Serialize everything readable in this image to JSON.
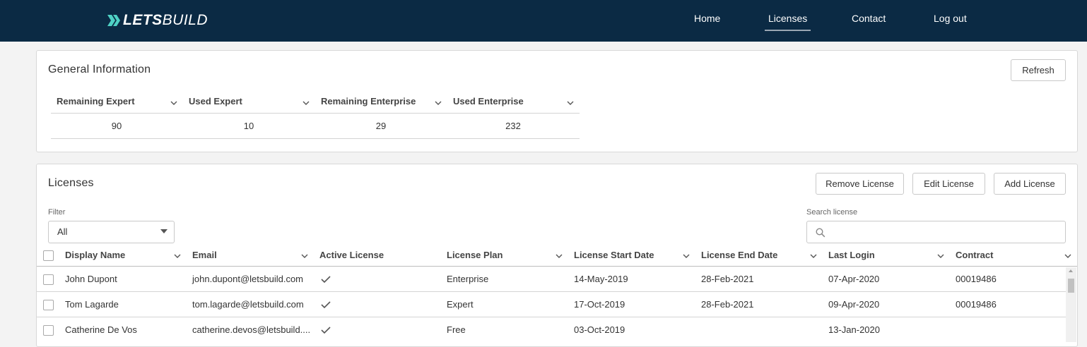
{
  "header": {
    "brand_bold": "LETS",
    "brand_light": "BUILD",
    "nav": [
      {
        "label": "Home"
      },
      {
        "label": "Licenses"
      },
      {
        "label": "Contact"
      },
      {
        "label": "Log out"
      }
    ],
    "active_nav": "Licenses",
    "colors": {
      "background": "#0b2a44",
      "logo_accent": "#4fd1c5"
    }
  },
  "general_info": {
    "title": "General Information",
    "refresh_label": "Refresh",
    "columns": [
      "Remaining Expert",
      "Used Expert",
      "Remaining Enterprise",
      "Used Enterprise"
    ],
    "values": [
      "90",
      "10",
      "29",
      "232"
    ]
  },
  "licenses": {
    "title": "Licenses",
    "buttons": {
      "remove": "Remove License",
      "edit": "Edit License",
      "add": "Add License"
    },
    "filter": {
      "label": "Filter",
      "value": "All"
    },
    "search": {
      "label": "Search license",
      "placeholder": ""
    },
    "columns": [
      "Display Name",
      "Email",
      "Active License",
      "License Plan",
      "License Start Date",
      "License End Date",
      "Last Login",
      "Contract"
    ],
    "rows": [
      {
        "name": "John Dupont",
        "email": "john.dupont@letsbuild.com",
        "active": true,
        "plan": "Enterprise",
        "start": "14-May-2019",
        "end": "28-Feb-2021",
        "last_login": "07-Apr-2020",
        "contract": "00019486"
      },
      {
        "name": "Tom Lagarde",
        "email": "tom.lagarde@letsbuild.com",
        "active": true,
        "plan": "Expert",
        "start": "17-Oct-2019",
        "end": "28-Feb-2021",
        "last_login": "09-Apr-2020",
        "contract": "00019486"
      },
      {
        "name": "Catherine De Vos",
        "email": "catherine.devos@letsbuild....",
        "active": true,
        "plan": "Free",
        "start": "03-Oct-2019",
        "end": "",
        "last_login": "13-Jan-2020",
        "contract": ""
      }
    ]
  }
}
